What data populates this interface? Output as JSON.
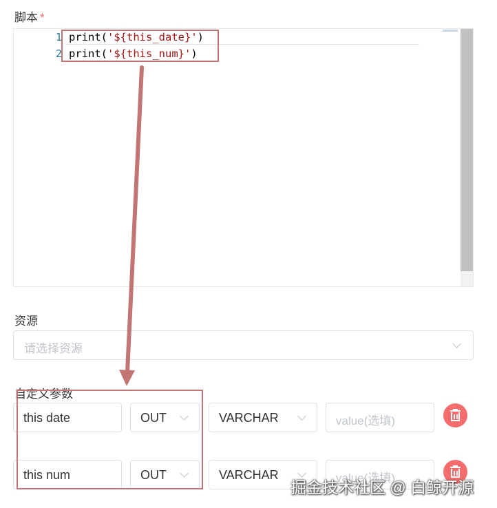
{
  "script": {
    "label": "脚本",
    "required_mark": "*",
    "editor": {
      "line_numbers": [
        "1",
        "2"
      ],
      "lines": [
        {
          "prefix": "print(",
          "string": "'${this_date}'",
          "suffix": ")"
        },
        {
          "prefix": "print(",
          "string": "'${this_num}'",
          "suffix": ")"
        }
      ]
    }
  },
  "resources": {
    "label": "资源",
    "placeholder": "请选择资源"
  },
  "custom_params": {
    "label": "自定义参数",
    "rows": [
      {
        "name": "this date",
        "direction": "OUT",
        "type": "VARCHAR",
        "value_placeholder": "value(选填)"
      },
      {
        "name": "this num",
        "direction": "OUT",
        "type": "VARCHAR",
        "value_placeholder": "value(选填)"
      }
    ]
  },
  "watermark": "掘金技术社区 @ 白鲸开源",
  "colors": {
    "annotation": "#c27572",
    "delete_button": "#f56c6c",
    "required": "#f56c6c",
    "line_number": "#237893",
    "code_string": "#a31515"
  }
}
